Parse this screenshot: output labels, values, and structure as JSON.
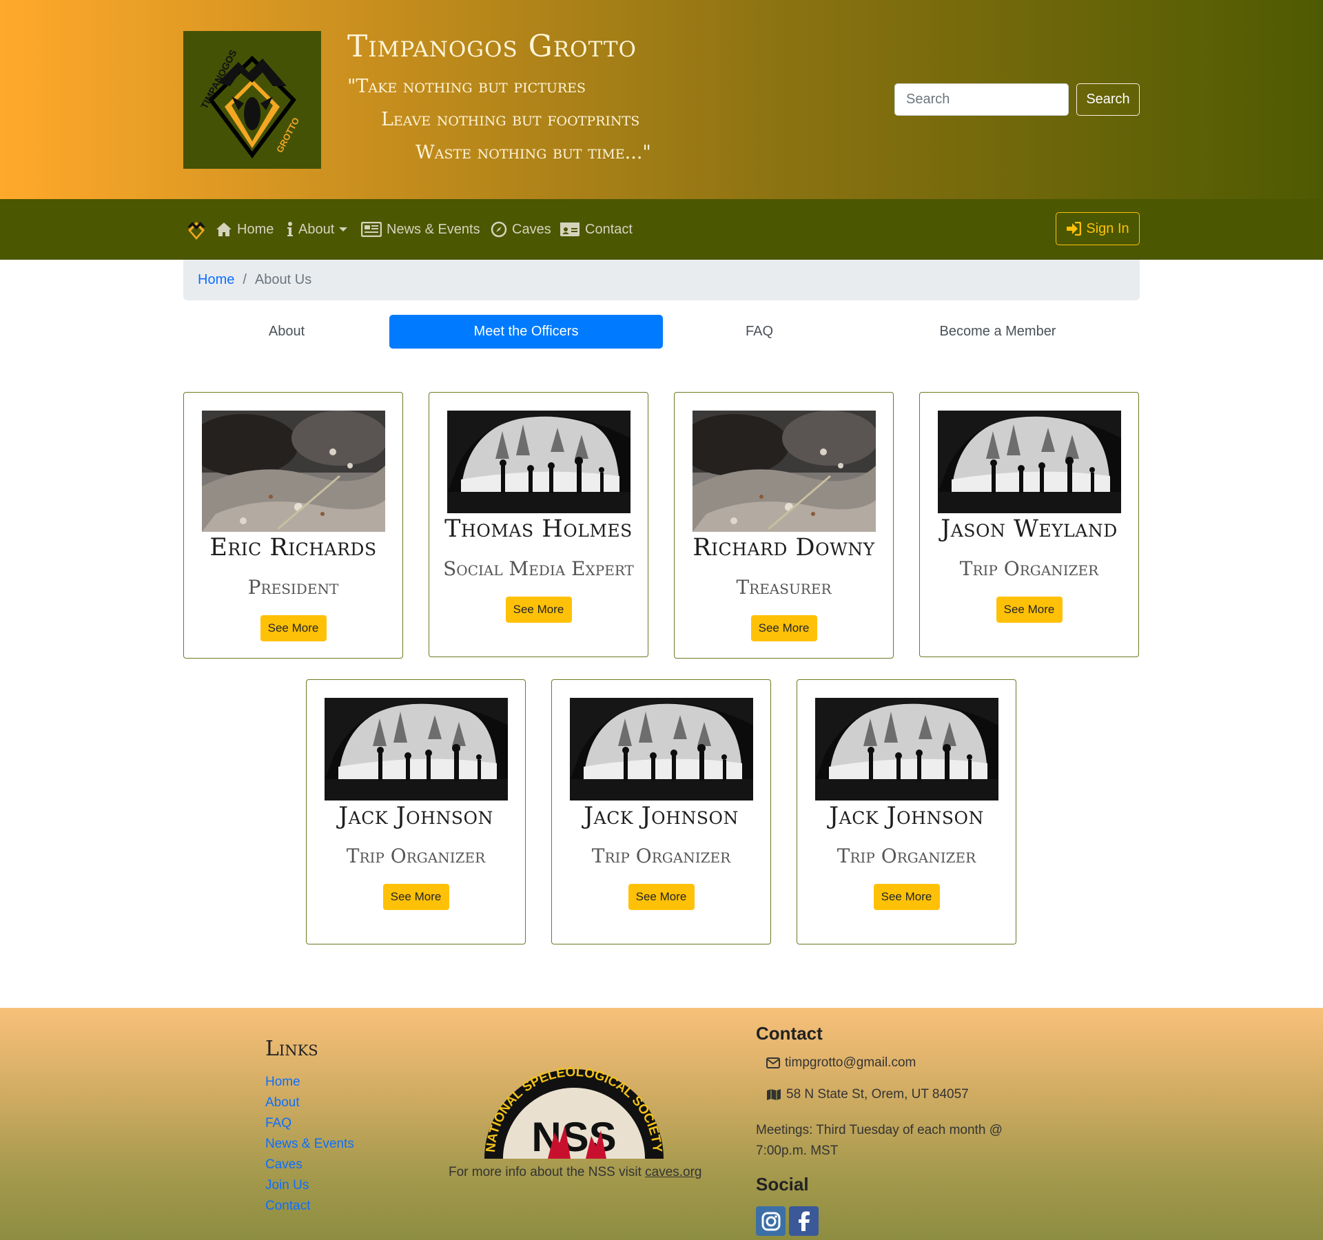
{
  "header": {
    "title": "Timpanogos Grotto",
    "motto": [
      "\"Take nothing but pictures",
      "Leave nothing but footprints",
      "Waste nothing but time...\""
    ],
    "logo_text": [
      "TIMPANOGOS",
      "GROTTO"
    ],
    "search": {
      "placeholder": "Search",
      "button_label": "Search"
    }
  },
  "nav": {
    "items": [
      {
        "label": "Home",
        "icon": "home-icon"
      },
      {
        "label": "About",
        "icon": "info-icon"
      },
      {
        "label": "News & Events",
        "icon": "newspaper-icon"
      },
      {
        "label": "Caves",
        "icon": "compass-icon"
      },
      {
        "label": "Contact",
        "icon": "id-card-icon"
      }
    ],
    "signin_label": "Sign In"
  },
  "breadcrumb": {
    "home": "Home",
    "separator": "/",
    "current": "About Us"
  },
  "tabs": [
    {
      "label": "About",
      "active": false
    },
    {
      "label": "Meet the Officers",
      "active": true
    },
    {
      "label": "FAQ",
      "active": false
    },
    {
      "label": "Become a Member",
      "active": false
    }
  ],
  "officers": [
    {
      "name": "Eric Richards",
      "role": "President",
      "photo": "rock-closeup",
      "button": "See More"
    },
    {
      "name": "Thomas Holmes",
      "role": "Social Media Expert",
      "photo": "cave-silhouettes",
      "button": "See More"
    },
    {
      "name": "Richard Downy",
      "role": "Treasurer",
      "photo": "rock-closeup",
      "button": "See More"
    },
    {
      "name": "Jason Weyland",
      "role": "Trip Organizer",
      "photo": "cave-silhouettes",
      "button": "See More"
    },
    {
      "name": "Jack Johnson",
      "role": "Trip Organizer",
      "photo": "cave-silhouettes",
      "button": "See More"
    },
    {
      "name": "Jack Johnson",
      "role": "Trip Organizer",
      "photo": "cave-silhouettes",
      "button": "See More"
    },
    {
      "name": "Jack Johnson",
      "role": "Trip Organizer",
      "photo": "cave-silhouettes",
      "button": "See More"
    }
  ],
  "footer": {
    "links_heading": "Links",
    "links": [
      "Home",
      "About",
      "FAQ",
      "News & Events",
      "Caves",
      "Join Us",
      "Contact"
    ],
    "nss_logo_text": "NATIONAL SPELEOLOGICAL SOCIETY",
    "nss_info": "For more info about the NSS visit",
    "nss_link": "caves.org",
    "contact_heading": "Contact",
    "email": "timpgrotto@gmail.com",
    "address": "58 N State St, Orem, UT 84057",
    "meetings": "Meetings: Third Tuesday of each month @ 7:00p.m. MST",
    "social_heading": "Social"
  },
  "colors": {
    "header_gradient": [
      "#ffa92b",
      "#4e5a02"
    ],
    "navbar": "#4b5701",
    "accent_yellow": "#ffc107",
    "active_tab": "#007bff",
    "link": "#0d6efd",
    "instagram": "#3b6fa6",
    "facebook": "#3b5998"
  }
}
